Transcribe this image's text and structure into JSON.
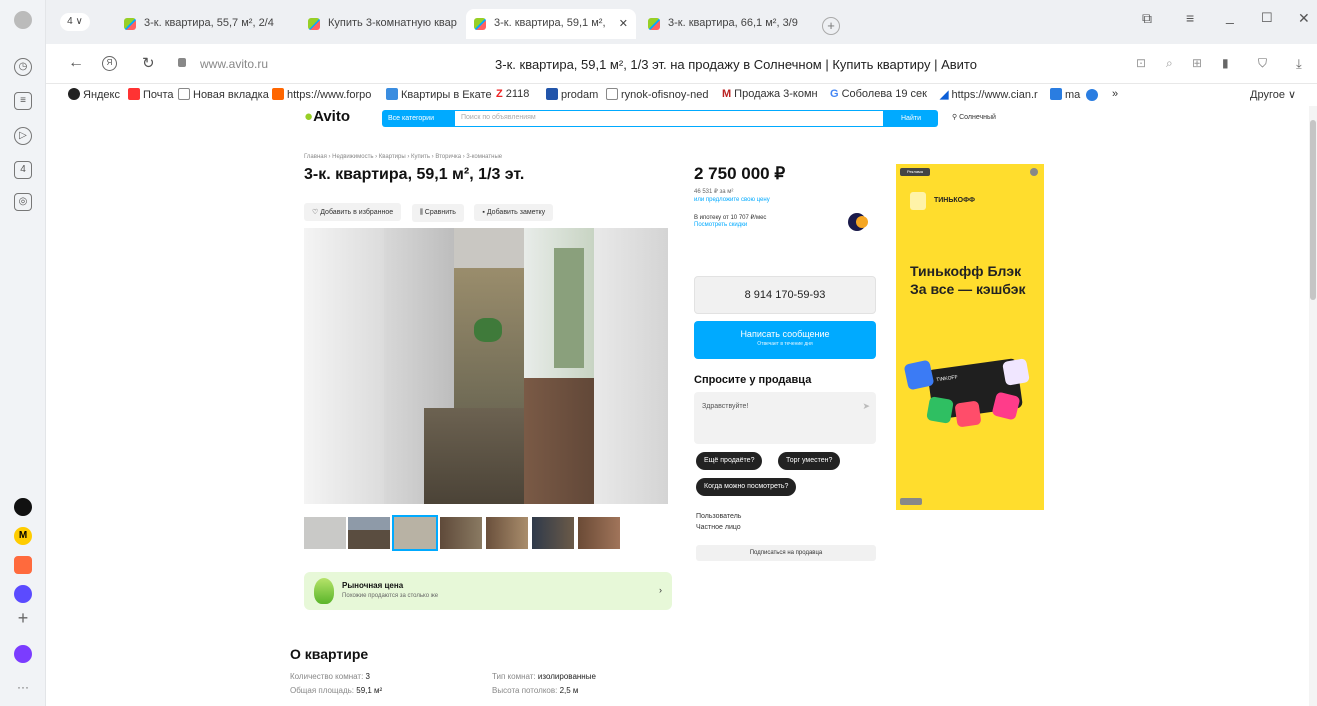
{
  "browser": {
    "tab_count": "4",
    "tabs": [
      {
        "label": "3-к. квартира, 55,7 м², 2/4"
      },
      {
        "label": "Купить 3-комнатную квар"
      },
      {
        "label": "3-к. квартира, 59,1 м², "
      },
      {
        "label": "3-к. квартира, 66,1 м², 3/9"
      }
    ],
    "address": "www.avito.ru",
    "page_title": "3-к. квартира, 59,1 м², 1/3 эт. на продажу в Солнечном | Купить квартиру | Авито",
    "bookmarks": [
      {
        "label": "Яндекс",
        "color": "#222"
      },
      {
        "label": "Почта",
        "color": "#f33"
      },
      {
        "label": "Новая вкладка",
        "color": "#999"
      },
      {
        "label": "https://www.forpo",
        "color": "#f60"
      },
      {
        "label": "Квартиры в Екате",
        "color": "#3a8de0"
      },
      {
        "label": "2118",
        "color": "#e22"
      },
      {
        "label": "prodam",
        "color": "#2255aa"
      },
      {
        "label": "rynok-ofisnoy-ned",
        "color": "#999"
      },
      {
        "label": "Продажа 3-комн",
        "color": "#b22"
      },
      {
        "label": "Соболева 19 сек",
        "color": "#4285f4"
      },
      {
        "label": "https://www.cian.r",
        "color": "#0b5ed7"
      },
      {
        "label": "ma",
        "color": "#2a7de1"
      }
    ],
    "bookmarks_more": "»",
    "bookmarks_other": "Другое ∨"
  },
  "avito": {
    "logo": "Avito",
    "all_categories": "Все категории",
    "search_placeholder": "Поиск по объявлениям",
    "search_button": "Найти",
    "location": "Солнечный",
    "breadcrumb": "Главная › Недвижимость › Квартиры › Купить › Вторичка › 3-комнатные",
    "title": "3-к. квартира, 59,1 м², 1/3 эт.",
    "actions": {
      "favorite": "Добавить в избранное",
      "compare": "Сравнить",
      "note": "Добавить заметку"
    },
    "price": "2 750 000 ₽",
    "price_per_m2": "46 531 ₽ за м²",
    "offer_price": "или предложите свою цену",
    "mortgage": "В ипотеку от 10 707 ₽/мес",
    "view_discount": "Посмотреть скидки",
    "phone": "8 914 170-59-93",
    "write_message": "Написать сообщение",
    "reply_time": "Отвечает в течение дня",
    "ask_seller": "Спросите у продавца",
    "ask_placeholder": "Здравствуйте!",
    "quick_questions": [
      "Ещё продаёте?",
      "Торг уместен?",
      "Когда можно посмотреть?"
    ],
    "seller_name": "Пользователь",
    "seller_type": "Частное лицо",
    "subscribe": "Подписаться на продавца",
    "market_price_title": "Рыночная цена",
    "market_price_sub": "Похожие продаются за столько же",
    "about_title": "О квартире",
    "props": [
      {
        "k": "Количество комнат:",
        "v": "3"
      },
      {
        "k": "Тип комнат:",
        "v": "изолированные"
      },
      {
        "k": "Общая площадь:",
        "v": "59,1 м²"
      },
      {
        "k": "Высота потолков:",
        "v": "2,5 м"
      }
    ],
    "ad": {
      "badge1": "Реклама",
      "brand": "ТИНЬКОФФ",
      "headline": "Тинькофф Блэк За все — кэшбэк",
      "card_brand": "TINKOFF"
    }
  }
}
